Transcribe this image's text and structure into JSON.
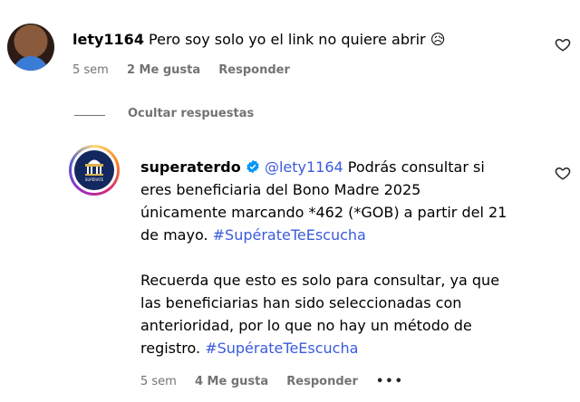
{
  "comment": {
    "username": "lety1164",
    "text": "Pero soy solo yo el link no quiere abrir",
    "emoji": "😥",
    "time": "5 sem",
    "likes": "2 Me gusta",
    "reply": "Responder"
  },
  "replies_toggle": "Ocultar respuestas",
  "reply": {
    "username": "superaterdo",
    "mention": "@lety1164",
    "line1_rest": " Podrás consultar si",
    "line2": "eres beneficiaria del Bono Madre 2025",
    "line3": "únicamente marcando *462 (*GOB) a partir del 21",
    "line4_pre": "de mayo. ",
    "hashtag1": "#SupérateTeEscucha",
    "para2_line1": "Recuerda que esto es solo para consultar, ya que",
    "para2_line2": "las beneficiarias han sido seleccionadas con",
    "para2_line3": "anterioridad, por lo que no hay un método de",
    "para2_line4_pre": "registro. ",
    "hashtag2": "#SupérateTeEscucha",
    "time": "5 sem",
    "likes": "4 Me gusta",
    "reply": "Responder",
    "more": "•••",
    "logo_text": "SUPÉRATE"
  },
  "icons": {
    "heart": "heart-outline-icon",
    "verified": "verified-badge-icon"
  },
  "colors": {
    "link": "#3b5bdb",
    "meta": "#737373",
    "verified": "#0095f6"
  }
}
